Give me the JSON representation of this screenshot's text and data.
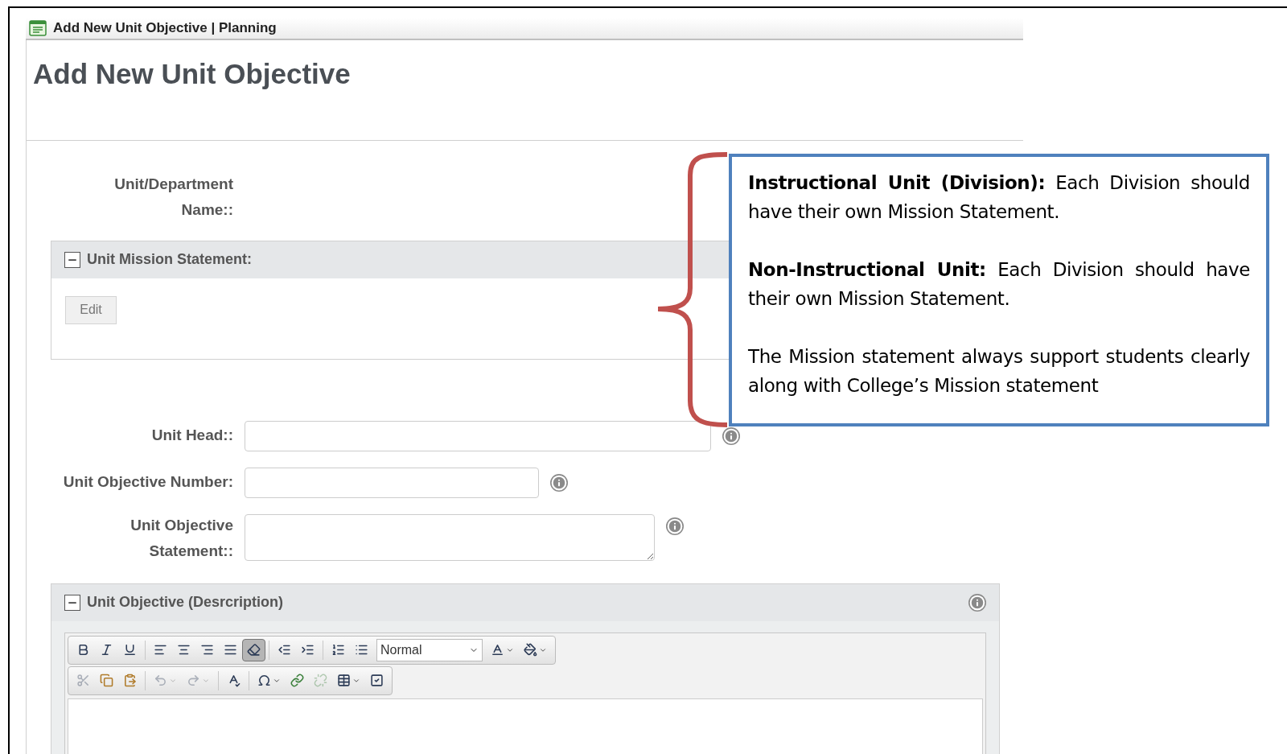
{
  "window": {
    "title": "Add New Unit Objective | Planning"
  },
  "heading": "Add New Unit Objective",
  "department_label_line1": "Unit/Department",
  "department_label_line2": "Name::",
  "mission_section": {
    "title": "Unit Mission Statement:",
    "expanded": true,
    "edit_button": "Edit"
  },
  "fields": [
    {
      "kind": "input",
      "label": "Unit Head::",
      "wide": true
    },
    {
      "kind": "input",
      "label": "Unit Objective Number:",
      "wide": false
    },
    {
      "kind": "textarea",
      "label_line1": "Unit Objective",
      "label_line2": "Statement::"
    }
  ],
  "description_section": {
    "title": "Unit Objective (Desrcription)",
    "expanded": true
  },
  "toolbar": {
    "rows": [
      [
        {
          "kind": "bold",
          "disabled": false,
          "pressed": false
        },
        {
          "kind": "italic",
          "disabled": false,
          "pressed": false
        },
        {
          "kind": "underline",
          "disabled": false,
          "pressed": false
        },
        {
          "kind": "sep"
        },
        {
          "kind": "align-left",
          "disabled": false,
          "pressed": false
        },
        {
          "kind": "align-center",
          "disabled": false,
          "pressed": false
        },
        {
          "kind": "align-right",
          "disabled": false,
          "pressed": false
        },
        {
          "kind": "align-justify",
          "disabled": false,
          "pressed": false
        },
        {
          "kind": "remove-format",
          "disabled": false,
          "pressed": true
        },
        {
          "kind": "sep"
        },
        {
          "kind": "outdent",
          "disabled": false,
          "pressed": false
        },
        {
          "kind": "indent",
          "disabled": false,
          "pressed": false
        },
        {
          "kind": "sep"
        },
        {
          "kind": "ordered-list",
          "disabled": false,
          "pressed": false
        },
        {
          "kind": "bullet-list",
          "disabled": false,
          "pressed": false
        },
        {
          "kind": "format",
          "value": "Normal"
        },
        {
          "kind": "text-color",
          "disabled": false,
          "pressed": false
        },
        {
          "kind": "fill-color",
          "disabled": false,
          "pressed": false
        }
      ],
      [
        {
          "kind": "cut",
          "disabled": true,
          "pressed": false
        },
        {
          "kind": "copy",
          "disabled": false,
          "pressed": false
        },
        {
          "kind": "paste",
          "disabled": false,
          "pressed": false
        },
        {
          "kind": "sep"
        },
        {
          "kind": "undo",
          "disabled": true,
          "pressed": false
        },
        {
          "kind": "redo",
          "disabled": true,
          "pressed": false
        },
        {
          "kind": "sep"
        },
        {
          "kind": "spellcheck",
          "disabled": false,
          "pressed": false
        },
        {
          "kind": "sep"
        },
        {
          "kind": "special-char",
          "disabled": false,
          "pressed": false
        },
        {
          "kind": "link",
          "disabled": false,
          "pressed": false
        },
        {
          "kind": "unlink",
          "disabled": true,
          "pressed": false
        },
        {
          "kind": "table",
          "disabled": false,
          "pressed": false
        },
        {
          "kind": "check",
          "disabled": false,
          "pressed": false
        }
      ]
    ]
  },
  "callout": {
    "paragraphs": [
      "**Instructional Unit (Division):** Each Division should have their own Mission Statement.",
      "**Non-Instructional Unit:** Each Division should have their own Mission Statement.",
      "The Mission statement always support students clearly along with College’s Mission statement"
    ]
  }
}
